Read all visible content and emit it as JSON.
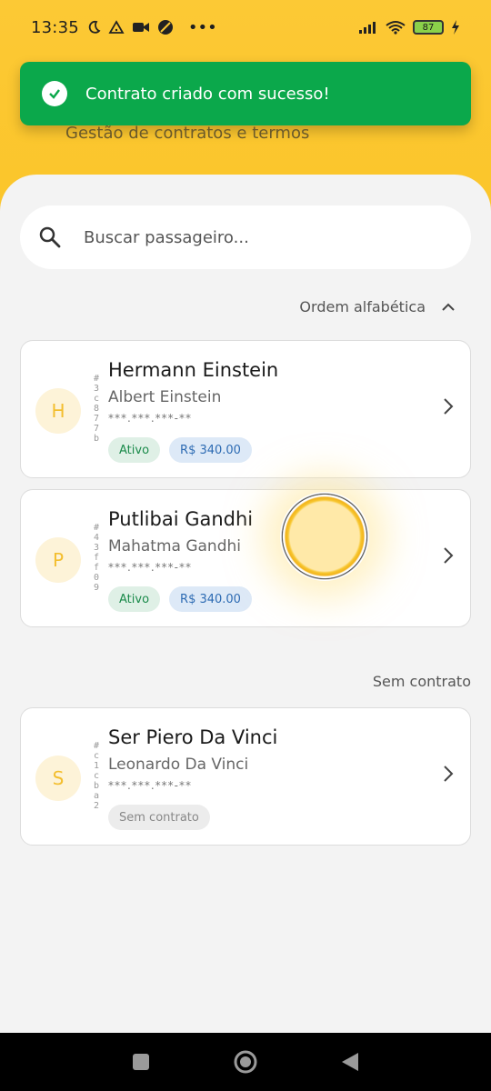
{
  "status_bar": {
    "time": "13:35",
    "battery": "87"
  },
  "toast": {
    "message": "Contrato criado com sucesso!"
  },
  "header": {
    "subtitle": "Gestão de contratos e termos"
  },
  "search": {
    "placeholder": "Buscar passageiro..."
  },
  "sort": {
    "label": "Ordem alfabética"
  },
  "cards": [
    {
      "initial": "H",
      "hash": "#3c877b",
      "name": "Hermann Einstein",
      "sub": "Albert Einstein",
      "cpf": "***.***.***-**",
      "status": "Ativo",
      "price": "R$ 340.00"
    },
    {
      "initial": "P",
      "hash": "#43ff09",
      "name": "Putlibai Gandhi",
      "sub": "Mahatma Gandhi",
      "cpf": "***.***.***-**",
      "status": "Ativo",
      "price": "R$ 340.00"
    }
  ],
  "no_contract_section": {
    "label": "Sem contrato"
  },
  "no_contract_cards": [
    {
      "initial": "S",
      "hash": "#c1cba2",
      "name": "Ser Piero Da Vinci",
      "sub": "Leonardo Da Vinci",
      "cpf": "***.***.***-**",
      "status": "Sem contrato"
    }
  ],
  "colors": {
    "header": "#fbc52a",
    "toast": "#0ba84b",
    "accent": "#f3be2e"
  }
}
